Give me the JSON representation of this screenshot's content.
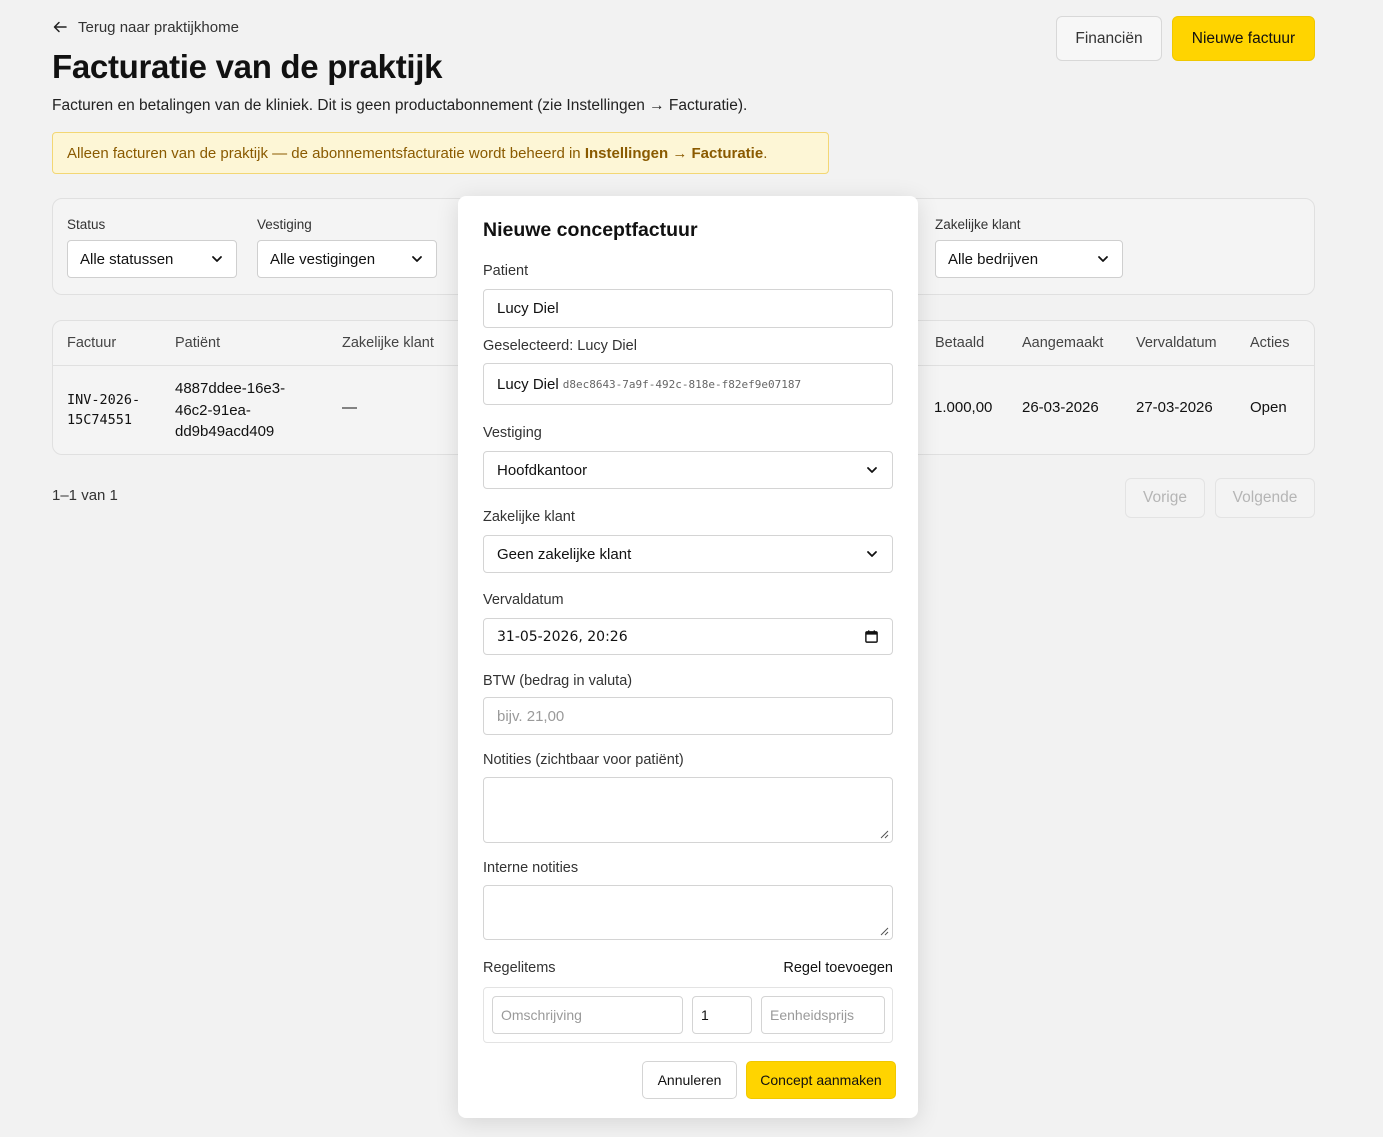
{
  "header": {
    "back_label": "Terug naar praktijkhome",
    "title": "Facturatie van de praktijk",
    "subtitle": "Facturen en betalingen van de kliniek. Dit is geen productabonnement (zie Instellingen → Facturatie).",
    "notice_prefix": "Alleen facturen van de praktijk — de abonnementsfacturatie wordt beheerd in ",
    "notice_bold": "Instellingen → Facturatie",
    "notice_suffix": ".",
    "finance_button": "Financiën",
    "new_invoice_button": "Nieuwe factuur"
  },
  "filters": {
    "status": {
      "label": "Status",
      "value": "Alle statussen"
    },
    "location": {
      "label": "Vestiging",
      "value": "Alle vestigingen"
    },
    "business_client": {
      "label": "Zakelijke klant",
      "value": "Alle bedrijven"
    }
  },
  "table": {
    "headers": {
      "invoice": "Factuur",
      "patient": "Patiënt",
      "business_client": "Zakelijke klant",
      "paid": "Betaald",
      "created": "Aangemaakt",
      "due": "Vervaldatum",
      "actions": "Acties"
    },
    "rows": [
      {
        "invoice_line1": "INV-2026-",
        "invoice_line2": "15C74551",
        "patient_line1": "4887ddee-16e3-",
        "patient_line2": "46c2-91ea-",
        "patient_line3": "dd9b49acd409",
        "business_client": "—",
        "paid": "1.000,00",
        "created": "26-03-2026",
        "due": "27-03-2026",
        "actions": "Open"
      }
    ]
  },
  "pagination": {
    "info": "1–1 van 1",
    "prev": "Vorige",
    "next": "Volgende"
  },
  "modal": {
    "title": "Nieuwe conceptfactuur",
    "patient_label": "Patient",
    "patient_value": "Lucy Diel",
    "selected_label": "Geselecteerd: Lucy Diel",
    "selected_name": "Lucy Diel",
    "selected_id": "d8ec8643-7a9f-492c-818e-f82ef9e07187",
    "location_label": "Vestiging",
    "location_value": "Hoofdkantoor",
    "business_label": "Zakelijke klant",
    "business_value": "Geen zakelijke klant",
    "due_label": "Vervaldatum",
    "due_value": "31-05-2026, 20:26",
    "vat_label": "BTW (bedrag in valuta)",
    "vat_placeholder": "bijv. 21,00",
    "notes_label": "Notities (zichtbaar voor patiënt)",
    "internal_notes_label": "Interne notities",
    "line_items_label": "Regelitems",
    "add_line": "Regel toevoegen",
    "description_placeholder": "Omschrijving",
    "quantity_value": "1",
    "unit_price_placeholder": "Eenheidsprijs",
    "cancel_button": "Annuleren",
    "create_button": "Concept aanmaken"
  },
  "colors": {
    "accent": "#ffd400",
    "notice_bg": "#fdf6d6",
    "notice_text": "#8a5a00"
  }
}
